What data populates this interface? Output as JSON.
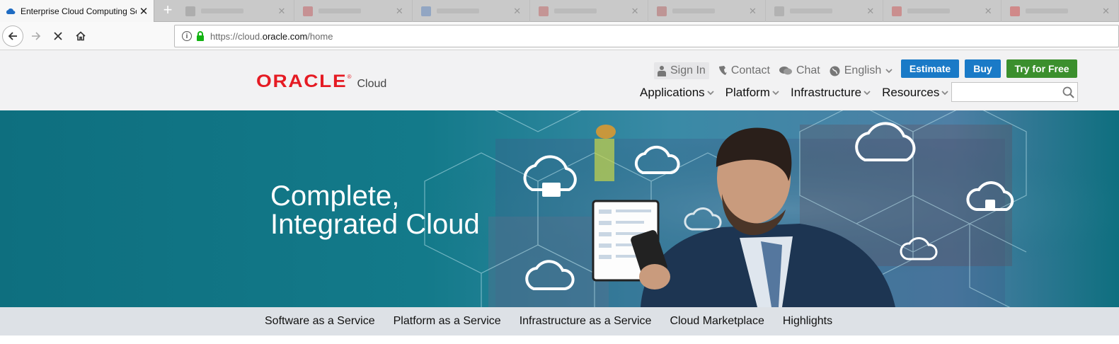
{
  "browser": {
    "active_tab_title": "Enterprise Cloud Computing So",
    "new_tab_symbol": "+",
    "url_scheme": "https://cloud.",
    "url_host": "oracle.com",
    "url_path": "/home"
  },
  "header": {
    "logo_text": "ORACLE",
    "logo_reg": "®",
    "logo_sub": "Cloud",
    "utility": {
      "sign_in": "Sign In",
      "contact": "Contact",
      "chat": "Chat",
      "language": "English"
    },
    "buttons": {
      "estimate": "Estimate",
      "buy": "Buy",
      "try_free": "Try for Free"
    },
    "nav": [
      "Applications",
      "Platform",
      "Infrastructure",
      "Resources"
    ],
    "search_placeholder": ""
  },
  "hero": {
    "title_line1": "Complete,",
    "title_line2": "Integrated Cloud"
  },
  "sub_nav": [
    "Software as a Service",
    "Platform as a Service",
    "Infrastructure as a Service",
    "Cloud Marketplace",
    "Highlights"
  ],
  "colors": {
    "brand_red": "#e51b23",
    "button_blue": "#1a7ac7",
    "button_green": "#3b8f2d",
    "hero_teal": "#0f7080"
  }
}
